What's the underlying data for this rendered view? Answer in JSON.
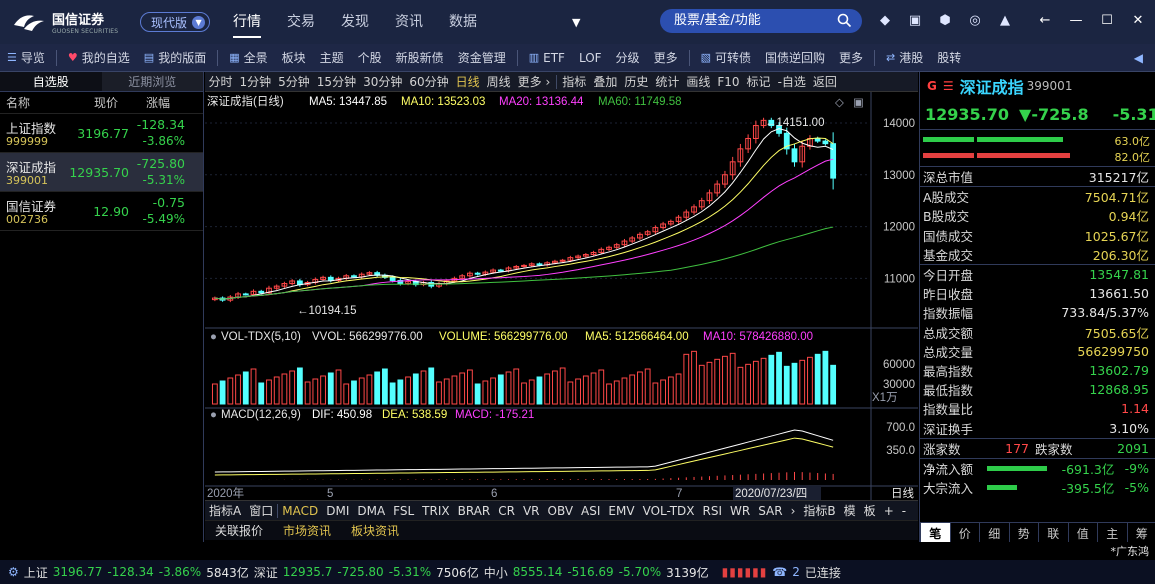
{
  "app": {
    "brand_name": "国信证券",
    "brand_sub": "GUOSEN SECURITIES",
    "mode_label": "现代版",
    "nav": [
      "行情",
      "交易",
      "发现",
      "资讯",
      "数据"
    ],
    "active_nav": "行情",
    "search_placeholder": "股票/基金/功能"
  },
  "toolbar": [
    "导览",
    "我的自选",
    "我的版面",
    "全景",
    "板块",
    "主题",
    "个股",
    "新股新债",
    "资金管理",
    "ETF",
    "LOF",
    "分级",
    "更多",
    "可转债",
    "国债逆回购",
    "更多",
    "港股",
    "股转"
  ],
  "left_panel": {
    "tabs": [
      "自选股",
      "近期浏览"
    ],
    "headers": [
      "名称",
      "现价",
      "涨幅"
    ],
    "rows": [
      {
        "name": "上证指数",
        "code": "999999",
        "price": "3196.77",
        "change": "-128.34",
        "pct": "-3.86%"
      },
      {
        "name": "深证成指",
        "code": "399001",
        "price": "12935.70",
        "change": "-725.80",
        "pct": "-5.31%"
      },
      {
        "name": "国信证券",
        "code": "002736",
        "price": "12.90",
        "change": "-0.75",
        "pct": "-5.49%"
      }
    ]
  },
  "chart_toolbar": [
    "分时",
    "1分钟",
    "5分钟",
    "15分钟",
    "30分钟",
    "60分钟",
    "日线",
    "周线",
    "更多 ›",
    "指标",
    "叠加",
    "历史",
    "统计",
    "画线",
    "F10",
    "标记",
    "-自选",
    "返回"
  ],
  "chart_toolbar_active": "日线",
  "chart_labels": {
    "title": "深证成指(日线)",
    "ma5": "MA5: 13447.85",
    "ma10": "MA10: 13523.03",
    "ma20": "MA20: 13136.44",
    "ma60": "MA60: 11749.58",
    "high_marker": "14151.00",
    "low_marker": "10194.15",
    "vol_title": "VOL-TDX(5,10)",
    "vvol": "VVOL: 566299776.00",
    "volume": "VOLUME: 566299776.00",
    "vol_ma5": "MA5: 512566464.00",
    "vol_ma10": "MA10: 578426880.00",
    "vol_unit": "X1万",
    "macd_title": "MACD(12,26,9)",
    "dif": "DIF: 450.98",
    "dea": "DEA: 538.59",
    "macd": "MACD: -175.21",
    "date_start": "2020年",
    "date_sel": "2020/07/23/四",
    "period": "日线"
  },
  "chart_data": {
    "type": "line",
    "title": "深证成指(日线)",
    "y_ticks": [
      14000,
      13000,
      12000,
      11000
    ],
    "vol_ticks": [
      60000,
      30000
    ],
    "macd_ticks": [
      700.0,
      350.0
    ],
    "x_ticks": [
      "5",
      "6",
      "7"
    ],
    "y_range": [
      10100,
      14250
    ],
    "close": [
      10620,
      10580,
      10640,
      10700,
      10690,
      10750,
      10720,
      10810,
      10850,
      10900,
      10950,
      10880,
      10920,
      10980,
      11020,
      10960,
      11000,
      11050,
      11030,
      11080,
      11110,
      11060,
      11020,
      10960,
      10900,
      10940,
      10880,
      10920,
      10850,
      10900,
      10950,
      11000,
      11050,
      11100,
      11080,
      11120,
      11160,
      11150,
      11200,
      11230,
      11250,
      11280,
      11260,
      11300,
      11330,
      11350,
      11400,
      11430,
      11460,
      11500,
      11560,
      11600,
      11650,
      11720,
      11780,
      11850,
      11900,
      11980,
      12050,
      12100,
      12180,
      12280,
      12380,
      12500,
      12650,
      12820,
      13000,
      13250,
      13500,
      13700,
      13950,
      14050,
      13950,
      13800,
      13500,
      13250,
      13550,
      13700,
      13650,
      13600,
      12935.7
    ],
    "vol_ma5": 512566464,
    "vol_ma10": 578426880
  },
  "bottom_tabs": [
    "指标A",
    "窗口",
    "MACD",
    "DMI",
    "DMA",
    "FSL",
    "TRIX",
    "BRAR",
    "CR",
    "VR",
    "OBV",
    "ASI",
    "EMV",
    "VOL-TDX",
    "RSI",
    "WR",
    "SAR",
    "›",
    "指标B",
    "模",
    "板",
    "+",
    "-"
  ],
  "bottom_active": "MACD",
  "news_tabs": [
    "关联报价",
    "市场资讯",
    "板块资讯"
  ],
  "right_panel": {
    "g": "G",
    "name": "深证成指",
    "code": "399001",
    "price": "12935.70",
    "change": "▼-725.8",
    "pct": "-5.31%",
    "bar1": "63.0亿",
    "bar2": "82.0亿",
    "rows1": [
      [
        "深总市值",
        "315217亿"
      ]
    ],
    "rows2": [
      [
        "A股成交",
        "7504.71亿"
      ],
      [
        "B股成交",
        "0.94亿"
      ],
      [
        "国债成交",
        "1025.67亿"
      ],
      [
        "基金成交",
        "206.30亿"
      ]
    ],
    "rows3": [
      [
        "今日开盘",
        "13547.81"
      ],
      [
        "昨日收盘",
        "13661.50"
      ],
      [
        "指数振幅",
        "733.84/5.37%"
      ],
      [
        "总成交额",
        "7505.65亿"
      ],
      [
        "总成交量",
        "566299750"
      ],
      [
        "最高指数",
        "13602.79"
      ],
      [
        "最低指数",
        "12868.95"
      ],
      [
        "指数量比",
        "1.14"
      ],
      [
        "深证换手",
        "3.10%"
      ]
    ],
    "updown_label_up": "涨家数",
    "updown_up": "177",
    "updown_label_down": "跌家数",
    "updown_down": "2091",
    "net_in": [
      "净流入额",
      "-691.3亿",
      "-9%"
    ],
    "big_in": [
      "大宗流入",
      "-395.5亿",
      "-5%"
    ],
    "tabs": [
      "笔",
      "价",
      "细",
      "势",
      "联",
      "值",
      "主",
      "筹"
    ]
  },
  "ticker_text": "*广东鸿",
  "statusbar": {
    "sh": "上证",
    "sh_price": "3196.77",
    "sh_change": "-128.34",
    "sh_pct": "-3.86%",
    "sh_vol": "5843亿",
    "sz": "深证",
    "sz_price": "12935.7",
    "sz_change": "-725.80",
    "sz_pct": "-5.31%",
    "sz_vol": "7506亿",
    "zx": "中小",
    "zx_price": "8555.14",
    "zx_change": "-516.69",
    "zx_pct": "-5.70%",
    "zx_vol": "3139亿",
    "conn": "已连接",
    "conn_num": "2"
  }
}
